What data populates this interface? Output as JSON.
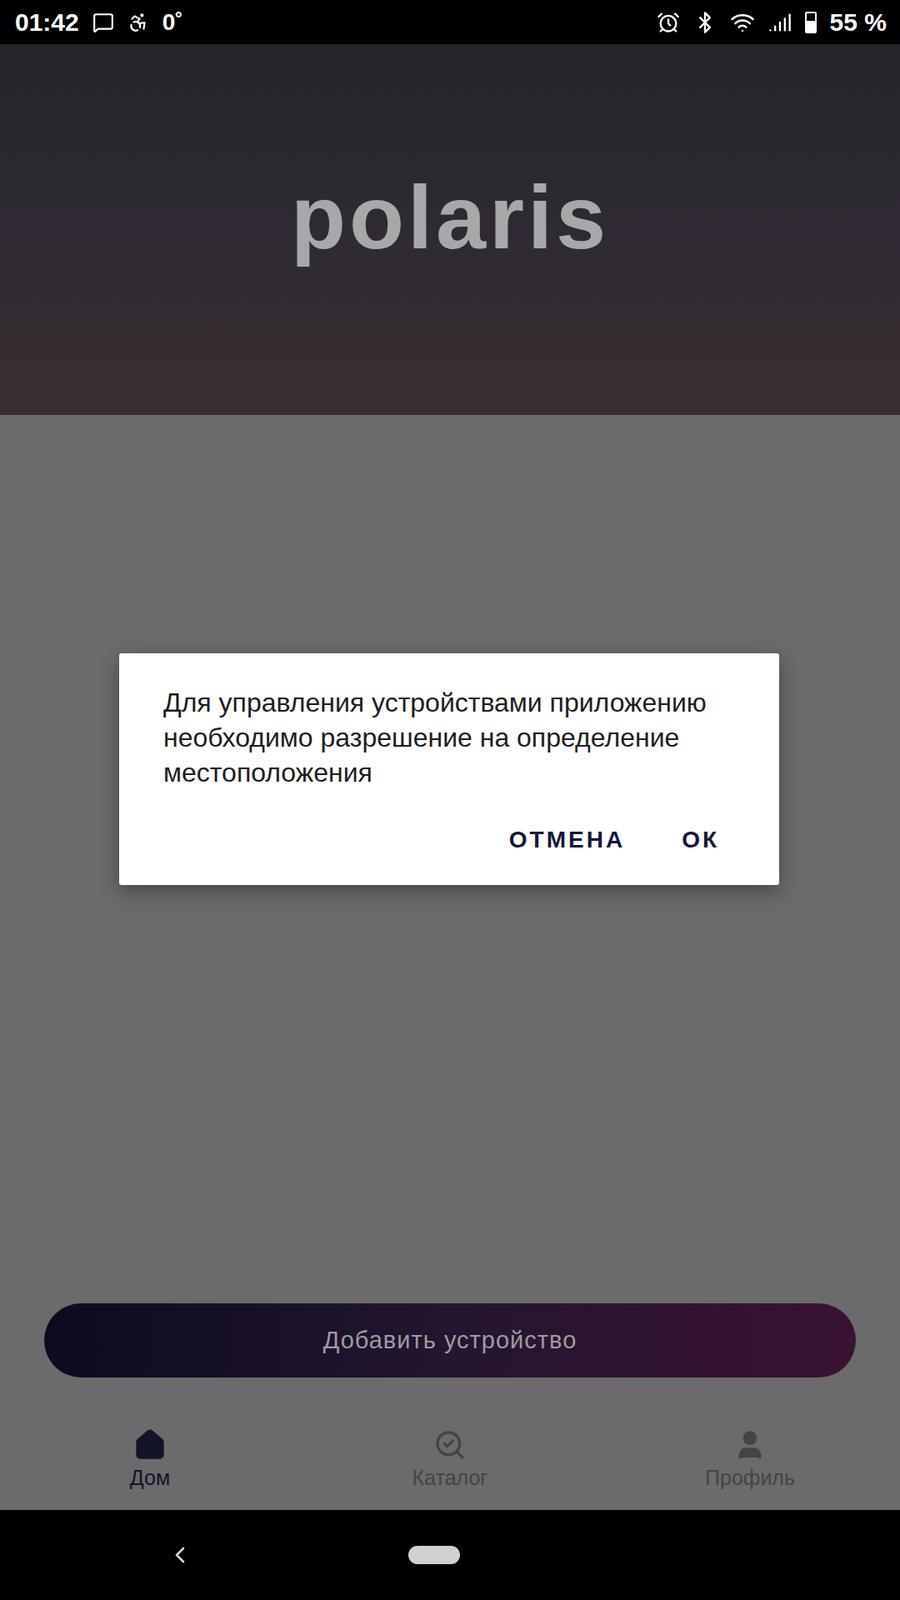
{
  "status_bar": {
    "time": "01:42",
    "temperature": "0˚",
    "battery": "55 %",
    "battery_level": 0.55
  },
  "header": {
    "logo": "polaris"
  },
  "dialog": {
    "message": "Для управления устройствами приложению необходимо разрешение на определение местоположения",
    "buttons": [
      "ОТМЕНА",
      "ОК"
    ]
  },
  "add_button": {
    "label": "Добавить устройство"
  },
  "bottom_nav": [
    {
      "label": "Дом",
      "selected": true
    },
    {
      "label": "Каталог",
      "selected": false
    },
    {
      "label": "Профиль",
      "selected": false
    }
  ]
}
